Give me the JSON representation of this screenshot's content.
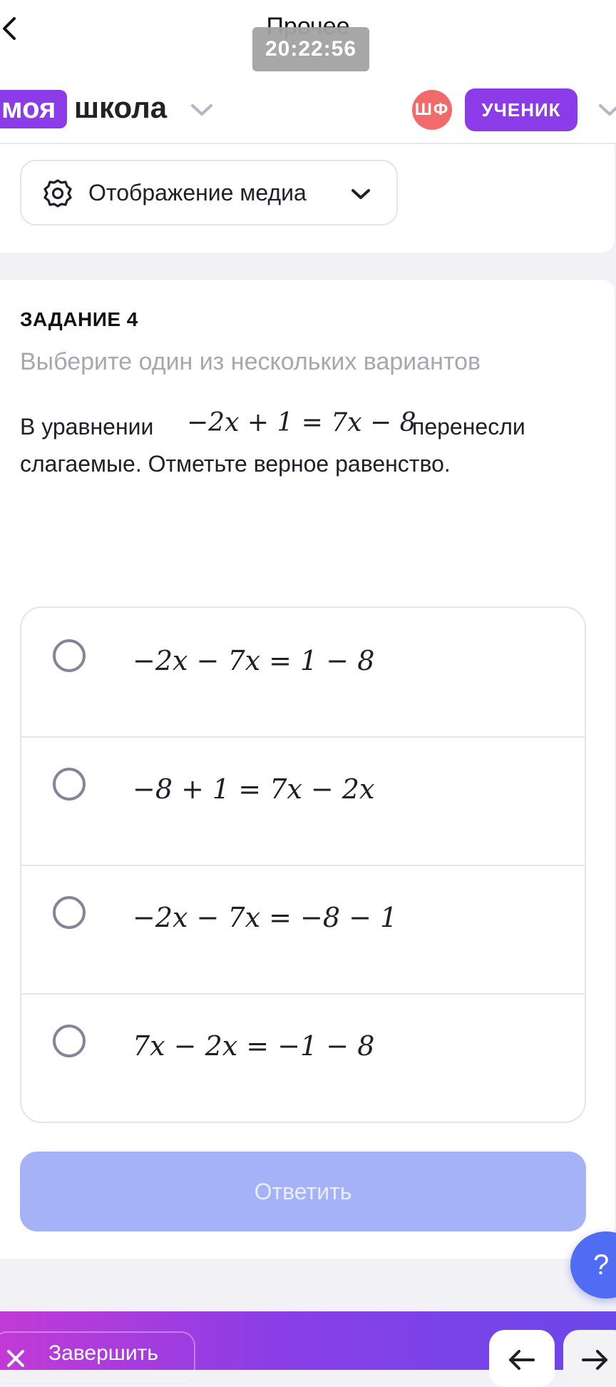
{
  "top_bar": {
    "title": "Прочее",
    "time": "20:22:56"
  },
  "header": {
    "logo_part1": "моя",
    "logo_part2": "школа",
    "avatar_initials": "ШФ",
    "role": "УЧЕНИК"
  },
  "media": {
    "label": "Отображение медиа"
  },
  "task": {
    "title": "ЗАДАНИЕ 4",
    "subtitle": "Выберите один из нескольких вариантов",
    "question_lead": "В уравнении",
    "question_equation": "−2x + 1 = 7x − 8",
    "question_tail": "перенесли",
    "question_line2": "слагаемые. Отметьте верное равенство.",
    "options": [
      {
        "expr": "−2x − 7x = 1 − 8"
      },
      {
        "expr": "−8 + 1 = 7x − 2x"
      },
      {
        "expr": "−2x − 7x = −8 − 1"
      },
      {
        "expr": "7x − 2x = −1 − 8"
      }
    ],
    "answer_label": "Ответить"
  },
  "help": {
    "label": "?"
  },
  "bottom": {
    "finish_label": "Завершить"
  },
  "colors": {
    "accent": "#8b3ce8",
    "answer_disabled": "#a6b2f7",
    "help": "#4f6cf2",
    "avatar": "#f26b6b"
  }
}
